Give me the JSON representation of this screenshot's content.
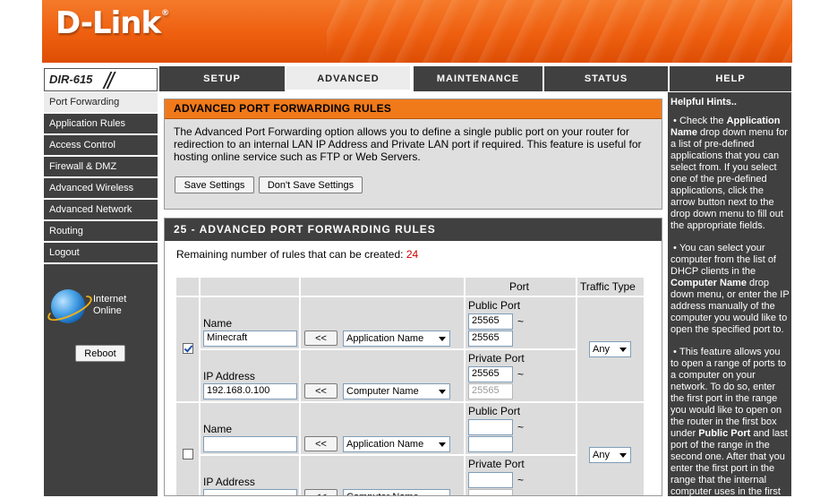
{
  "brand": {
    "logo": "D-Link",
    "registered": "®",
    "model": "DIR-615"
  },
  "tabs": [
    {
      "label": "SETUP",
      "active": false
    },
    {
      "label": "ADVANCED",
      "active": true
    },
    {
      "label": "MAINTENANCE",
      "active": false
    },
    {
      "label": "STATUS",
      "active": false
    },
    {
      "label": "HELP",
      "active": false
    }
  ],
  "sidebar": {
    "items": [
      {
        "label": "Port Forwarding",
        "active": true
      },
      {
        "label": "Application Rules",
        "active": false
      },
      {
        "label": "Access Control",
        "active": false
      },
      {
        "label": "Firewall & DMZ",
        "active": false
      },
      {
        "label": "Advanced Wireless",
        "active": false
      },
      {
        "label": "Advanced Network",
        "active": false
      },
      {
        "label": "Routing",
        "active": false
      },
      {
        "label": "Logout",
        "active": false
      }
    ],
    "internet_label_1": "Internet",
    "internet_label_2": "Online",
    "reboot_label": "Reboot"
  },
  "pf": {
    "title": "ADVANCED PORT FORWARDING RULES",
    "description": "The Advanced Port Forwarding option allows you to define a single public port on your router for redirection to an internal LAN IP Address and Private LAN port if required. This feature is useful for hosting online service such as FTP or Web Servers.",
    "save_label": "Save Settings",
    "dont_save_label": "Don't Save Settings"
  },
  "rules": {
    "title": "25 - ADVANCED PORT FORWARDING RULES",
    "remaining_label": "Remaining number of rules that can be created:",
    "remaining_count": "24",
    "col_port": "Port",
    "col_traffic": "Traffic Type",
    "name_label": "Name",
    "ip_label": "IP Address",
    "public_port_label": "Public Port",
    "private_port_label": "Private Port",
    "arrow_label": "<<",
    "tilde": "~",
    "app_select": "Application Name",
    "computer_select": "Computer Name",
    "rows": [
      {
        "checked": true,
        "name": "Minecraft",
        "ip": "192.168.0.100",
        "public_start": "25565",
        "public_end": "25565",
        "private_start": "25565",
        "private_end": "25565",
        "traffic": "Any"
      },
      {
        "checked": false,
        "name": "",
        "ip": "",
        "public_start": "",
        "public_end": "",
        "private_start": "",
        "private_end": "",
        "traffic": "Any"
      }
    ]
  },
  "hints": {
    "title": "Helpful Hints..",
    "p1_a": "Check the ",
    "p1_b": "Application Name",
    "p1_c": " drop down menu for a list of pre-defined applications that you can select from. If you select one of the pre-defined applications, click the arrow button next to the drop down menu to fill out the appropriate fields.",
    "p2_a": "You can select your computer from the list of DHCP clients in the ",
    "p2_b": "Computer Name",
    "p2_c": " drop down menu, or enter the IP address manually of the computer you would like to open the specified port to.",
    "p3_a": "This feature allows you to open a range of ports to a computer on your network. To do so, enter the first port in the range you would like to open on the router in the first box under ",
    "p3_b": "Public Port",
    "p3_c": " and last port of the range in the second one. After that you enter the first port in the range that the internal computer uses in the first"
  },
  "colors": {
    "banner": "#ee5f0f",
    "dark": "#404040",
    "accent": "#f07a1a",
    "panel": "#dfdfdf"
  }
}
